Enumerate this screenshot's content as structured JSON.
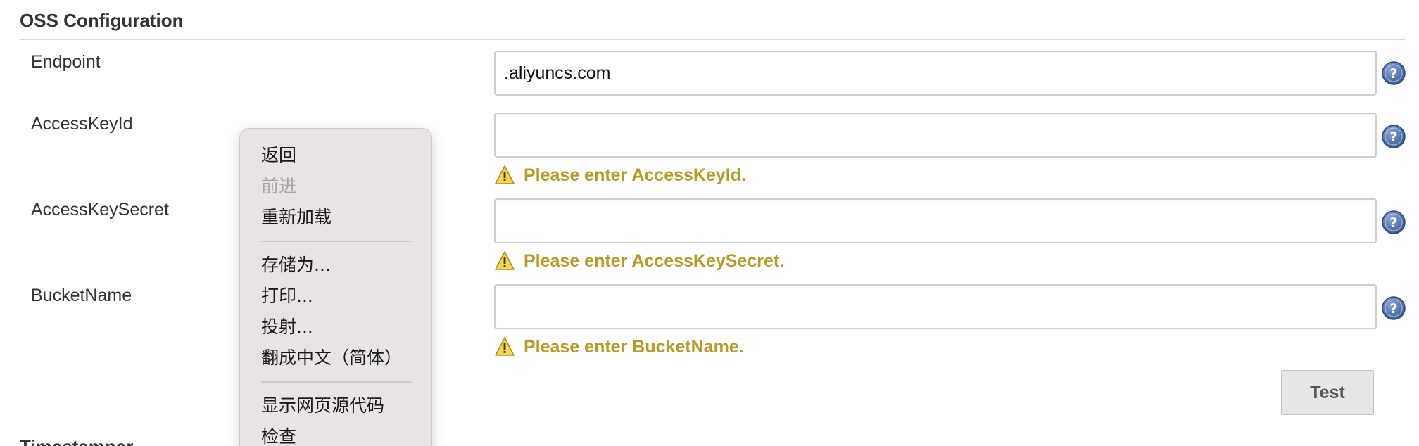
{
  "section": {
    "title": "OSS Configuration"
  },
  "fields": {
    "endpoint": {
      "label": "Endpoint",
      "value": ".aliyuncs.com"
    },
    "access_key_id": {
      "label": "AccessKeyId",
      "value": "",
      "warning": "Please enter AccessKeyId."
    },
    "access_key_secret": {
      "label": "AccessKeySecret",
      "value": "",
      "warning": "Please enter AccessKeySecret."
    },
    "bucket_name": {
      "label": "BucketName",
      "value": "",
      "warning": "Please enter BucketName."
    }
  },
  "buttons": {
    "test_label": "Test"
  },
  "next_section": {
    "title": "Timestamper"
  },
  "context_menu": {
    "items": [
      {
        "label": "返回",
        "enabled": true
      },
      {
        "label": "前进",
        "enabled": false
      },
      {
        "label": "重新加载",
        "enabled": true
      },
      {
        "label": "存储为...",
        "enabled": true
      },
      {
        "label": "打印...",
        "enabled": true
      },
      {
        "label": "投射...",
        "enabled": true
      },
      {
        "label": "翻成中文（简体）",
        "enabled": true
      },
      {
        "label": "显示网页源代码",
        "enabled": true
      },
      {
        "label": "检查",
        "enabled": true
      }
    ]
  },
  "colors": {
    "warning_text": "#b89a25",
    "help_icon": "#4a6aa8",
    "menu_background": "#e8e3e4"
  },
  "icons": {
    "help": "question-circle-icon",
    "warning": "warning-triangle-icon"
  }
}
